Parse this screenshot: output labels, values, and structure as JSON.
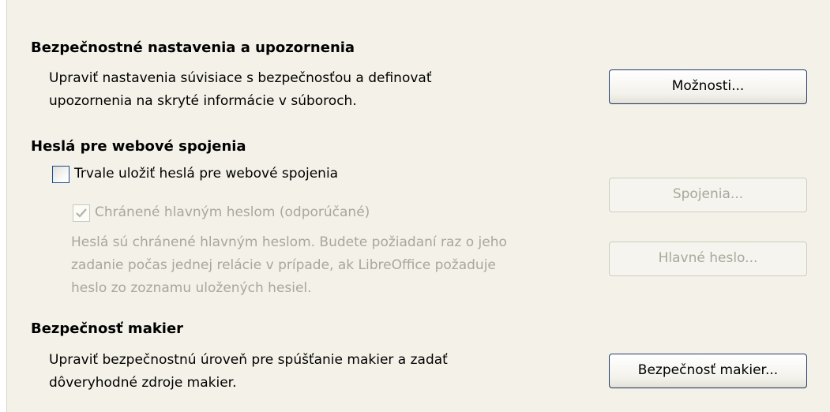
{
  "security": {
    "heading": "Bezpečnostné nastavenia a upozornenia",
    "desc_line1": "Upraviť nastavenia súvisiace s bezpečnosťou a definovať",
    "desc_line2": "upozornenia na skryté informácie v súboroch.",
    "options_button": "Možnosti..."
  },
  "passwords": {
    "heading": "Heslá pre webové spojenia",
    "persist_checkbox_label": "Trvale uložiť heslá pre webové spojenia",
    "persist_checked": false,
    "master_checkbox_label": "Chránené hlavným heslom (odporúčané)",
    "master_checked": true,
    "info_line1": "Heslá sú chránené hlavným heslom. Budete požiadaní raz o jeho",
    "info_line2": "zadanie počas jednej relácie v prípade, ak LibreOffice požaduje",
    "info_line3": "heslo zo zoznamu uložených hesiel.",
    "connections_button": "Spojenia...",
    "master_password_button": "Hlavné heslo..."
  },
  "macro": {
    "heading": "Bezpečnosť makier",
    "desc_line1": "Upraviť bezpečnostnú úroveň pre spúšťanie makier a zadať",
    "desc_line2": "dôveryhodné zdroje makier.",
    "macro_button": "Bezpečnosť makier..."
  }
}
